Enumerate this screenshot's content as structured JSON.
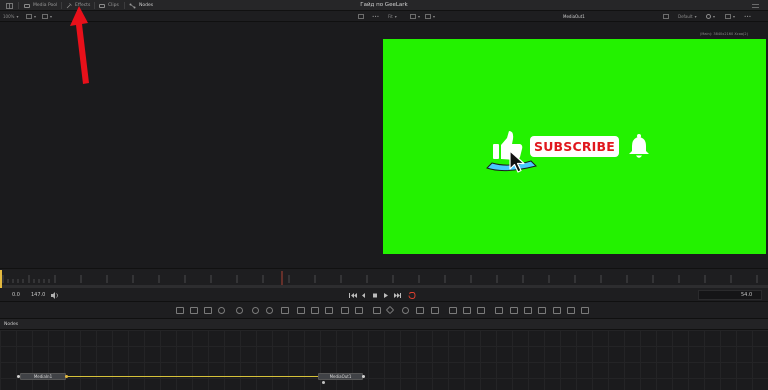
{
  "window": {
    "title": "Гайд по GeeLark"
  },
  "topbar": {
    "media_pool": "Media Pool",
    "effects": "Effects",
    "clips": "Clips",
    "nodes": "Nodes"
  },
  "left_viewer": {
    "zoom": "100%"
  },
  "right_viewer": {
    "fit": "Fit",
    "name": "MediaOut1",
    "preset": "Default",
    "format": "(Main): 3840x2160 Xcoa(2)"
  },
  "graphic": {
    "subscribe_text": "SUBSCRIBE"
  },
  "transport": {
    "start": "0.0",
    "end": "147.0",
    "current": "54.0"
  },
  "nodes_panel": {
    "title": "Nodes",
    "node_in": "MediaIn1",
    "node_out": "MediaOut1"
  },
  "colors": {
    "green_screen": "#23f200",
    "annotation_arrow": "#e8101a",
    "subscribe_red": "#e0171d",
    "link": "#d6c23a"
  },
  "icons": [
    "layout-icon",
    "media-pool-icon",
    "effects-icon",
    "clips-icon",
    "nodes-icon",
    "like-icon",
    "cursor-icon",
    "bell-icon",
    "play-icon",
    "stop-icon",
    "loop-icon",
    "volume-icon"
  ]
}
